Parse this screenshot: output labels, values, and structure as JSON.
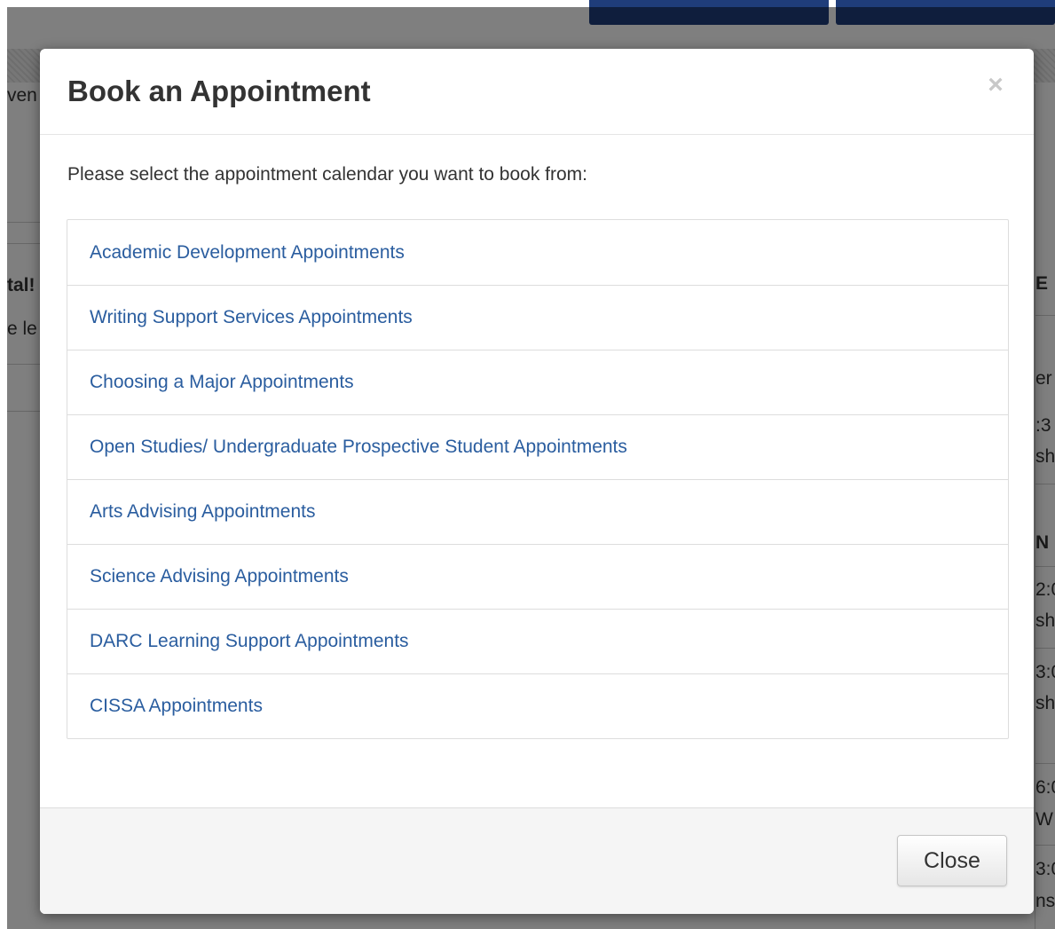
{
  "background": {
    "visible_fragments": {
      "left": [
        "ven",
        "tal!",
        "e le"
      ],
      "right": [
        "E",
        "er",
        ":3",
        "sh",
        "N",
        "2:0",
        "sh",
        "3:0",
        "sh",
        "6:0",
        "W",
        "3:0",
        "ns"
      ]
    }
  },
  "modal": {
    "title": "Book an Appointment",
    "close_x": "×",
    "intro": "Please select the appointment calendar you want to book from:",
    "calendars": [
      "Academic Development Appointments",
      "Writing Support Services Appointments",
      "Choosing a Major Appointments",
      "Open Studies/ Undergraduate Prospective Student Appointments",
      "Arts Advising Appointments",
      "Science Advising Appointments",
      "DARC Learning Support Appointments",
      "CISSA Appointments"
    ],
    "close_button_label": "Close"
  },
  "colors": {
    "link": "#2a5d9f",
    "header_buttons": "#1f3d7a",
    "overlay": "rgba(0,0,0,0.5)"
  }
}
